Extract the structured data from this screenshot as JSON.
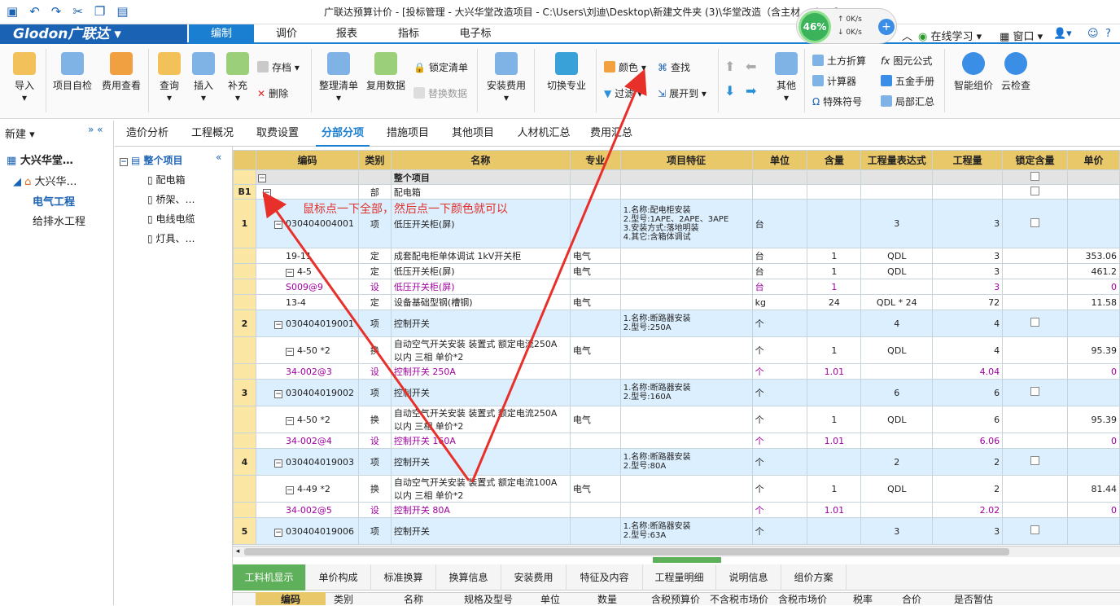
{
  "title": "广联达预算计价 - [投标管理 - 大兴华堂改造项目 - C:\\Users\\刘迪\\Desktop\\新建文件夹 (3)\\华堂改造（含主材...gbq5]",
  "speed": {
    "percent": "46%",
    "up": "0K/s",
    "down": "0K/s"
  },
  "logo": "Glodon广联达",
  "menu_tabs": [
    "编制",
    "调价",
    "报表",
    "指标",
    "电子标"
  ],
  "right_menu": {
    "online": "在线学习",
    "window": "窗口"
  },
  "ribbon": {
    "import": "导入",
    "check": "项目自检",
    "fee_view": "费用查看",
    "query": "查询",
    "insert": "插入",
    "supplement": "补充",
    "save": "存档",
    "delete": "删除",
    "organize": "整理清单",
    "reuse": "复用数据",
    "lock_list": "锁定清单",
    "replace": "替换数据",
    "install_fee": "安装费用",
    "switch": "切换专业",
    "color": "颜色",
    "find": "查找",
    "filter": "过滤",
    "expand": "展开到",
    "other": "其他",
    "earthwork": "土方折算",
    "formula": "图元公式",
    "calculator": "计算器",
    "hardware": "五金手册",
    "special": "特殊符号",
    "partial": "局部汇总",
    "smart": "智能组价",
    "cloud": "云检查"
  },
  "left": {
    "new": "新建",
    "project": "大兴华堂…",
    "sub": "大兴华…",
    "items": [
      "电气工程",
      "给排水工程"
    ]
  },
  "tree": {
    "root": "整个项目",
    "items": [
      "配电箱",
      "桥架、…",
      "电线电缆",
      "灯具、…"
    ]
  },
  "sub_tabs": [
    "造价分析",
    "工程概况",
    "取费设置",
    "分部分项",
    "措施项目",
    "其他项目",
    "人材机汇总",
    "费用汇总"
  ],
  "columns": [
    "编码",
    "类别",
    "名称",
    "专业",
    "项目特征",
    "单位",
    "含量",
    "工程量表达式",
    "工程量",
    "锁定含量",
    "单价"
  ],
  "rows": [
    {
      "num": "",
      "code": "",
      "type": "",
      "name": "整个项目",
      "spec": "",
      "feat": "",
      "unit": "",
      "qty": "",
      "expr": "",
      "amt": "",
      "price": "",
      "cls": "lv0",
      "h": 18
    },
    {
      "num": "B1",
      "code": "",
      "type": "部",
      "name": "配电箱",
      "spec": "",
      "feat": "",
      "unit": "",
      "qty": "",
      "expr": "",
      "amt": "",
      "price": "",
      "cls": "",
      "h": 18
    },
    {
      "num": "1",
      "code": "030404004001",
      "type": "项",
      "name": "低压开关柜(屏)",
      "spec": "",
      "feat": "1.名称:配电柜安装|2.型号:1APE、2APE、3APE|3.安装方式:落地明装|4.其它:含箱体调试",
      "unit": "台",
      "qty": "",
      "expr": "3",
      "amt": "3",
      "price": "",
      "cls": "lv1",
      "h": 60
    },
    {
      "num": "",
      "code": "19-11",
      "type": "定",
      "name": "成套配电柜单体调试 1kV开关柜",
      "spec": "电气",
      "feat": "",
      "unit": "台",
      "qty": "1",
      "expr": "QDL",
      "amt": "3",
      "price": "353.06",
      "cls": "",
      "h": 19
    },
    {
      "num": "",
      "code": "4-5",
      "type": "定",
      "name": "低压开关柜(屏)",
      "spec": "电气",
      "feat": "",
      "unit": "台",
      "qty": "1",
      "expr": "QDL",
      "amt": "3",
      "price": "461.2",
      "cls": "",
      "h": 19
    },
    {
      "num": "",
      "code": "S009@9",
      "type": "设",
      "name": "低压开关柜(屏)",
      "spec": "",
      "feat": "",
      "unit": "台",
      "qty": "1",
      "expr": "",
      "amt": "3",
      "price": "0",
      "cls": "purple",
      "h": 19
    },
    {
      "num": "",
      "code": "13-4",
      "type": "定",
      "name": "设备基础型钢(槽钢)",
      "spec": "电气",
      "feat": "",
      "unit": "kg",
      "qty": "24",
      "expr": "QDL * 24",
      "amt": "72",
      "price": "11.58",
      "cls": "",
      "h": 19
    },
    {
      "num": "2",
      "code": "030404019001",
      "type": "项",
      "name": "控制开关",
      "spec": "",
      "feat": "1.名称:断路器安装|2.型号:250A",
      "unit": "个",
      "qty": "",
      "expr": "4",
      "amt": "4",
      "price": "",
      "cls": "lv1",
      "h": 33
    },
    {
      "num": "",
      "code": "4-50 *2",
      "type": "换",
      "name": "自动空气开关安装 装置式 额定电流250A|以内 三相  单价*2",
      "spec": "电气",
      "feat": "",
      "unit": "个",
      "qty": "1",
      "expr": "QDL",
      "amt": "4",
      "price": "95.39",
      "cls": "",
      "h": 33
    },
    {
      "num": "",
      "code": "34-002@3",
      "type": "设",
      "name": "控制开关 250A",
      "spec": "",
      "feat": "",
      "unit": "个",
      "qty": "1.01",
      "expr": "",
      "amt": "4.04",
      "price": "0",
      "cls": "purple",
      "h": 19
    },
    {
      "num": "3",
      "code": "030404019002",
      "type": "项",
      "name": "控制开关",
      "spec": "",
      "feat": "1.名称:断路器安装|2.型号:160A",
      "unit": "个",
      "qty": "",
      "expr": "6",
      "amt": "6",
      "price": "",
      "cls": "lv1",
      "h": 33
    },
    {
      "num": "",
      "code": "4-50 *2",
      "type": "换",
      "name": "自动空气开关安装 装置式 额定电流250A|以内 三相  单价*2",
      "spec": "电气",
      "feat": "",
      "unit": "个",
      "qty": "1",
      "expr": "QDL",
      "amt": "6",
      "price": "95.39",
      "cls": "",
      "h": 33
    },
    {
      "num": "",
      "code": "34-002@4",
      "type": "设",
      "name": "控制开关 160A",
      "spec": "",
      "feat": "",
      "unit": "个",
      "qty": "1.01",
      "expr": "",
      "amt": "6.06",
      "price": "0",
      "cls": "purple",
      "h": 19
    },
    {
      "num": "4",
      "code": "030404019003",
      "type": "项",
      "name": "控制开关",
      "spec": "",
      "feat": "1.名称:断路器安装|2.型号:80A",
      "unit": "个",
      "qty": "",
      "expr": "2",
      "amt": "2",
      "price": "",
      "cls": "lv1",
      "h": 33
    },
    {
      "num": "",
      "code": "4-49 *2",
      "type": "换",
      "name": "自动空气开关安装 装置式 额定电流100A|以内 三相  单价*2",
      "spec": "电气",
      "feat": "",
      "unit": "个",
      "qty": "1",
      "expr": "QDL",
      "amt": "2",
      "price": "81.44",
      "cls": "",
      "h": 33
    },
    {
      "num": "",
      "code": "34-002@5",
      "type": "设",
      "name": "控制开关 80A",
      "spec": "",
      "feat": "",
      "unit": "个",
      "qty": "1.01",
      "expr": "",
      "amt": "2.02",
      "price": "0",
      "cls": "purple",
      "h": 19
    },
    {
      "num": "5",
      "code": "030404019006",
      "type": "项",
      "name": "控制开关",
      "spec": "",
      "feat": "1.名称:断路器安装|2.型号:63A",
      "unit": "个",
      "qty": "",
      "expr": "3",
      "amt": "3",
      "price": "",
      "cls": "lv1",
      "h": 33
    }
  ],
  "bottom_tabs": [
    "工料机显示",
    "单价构成",
    "标准换算",
    "换算信息",
    "安装费用",
    "特征及内容",
    "工程量明细",
    "说明信息",
    "组价方案"
  ],
  "bottom_cols": [
    "编码",
    "类别",
    "名称",
    "规格及型号",
    "单位",
    "数量",
    "含税预算价",
    "不含税市场价",
    "含税市场价",
    "税率",
    "合价",
    "是否暂估"
  ],
  "annotation": "鼠标点一下全部，然后点一下颜色就可以"
}
